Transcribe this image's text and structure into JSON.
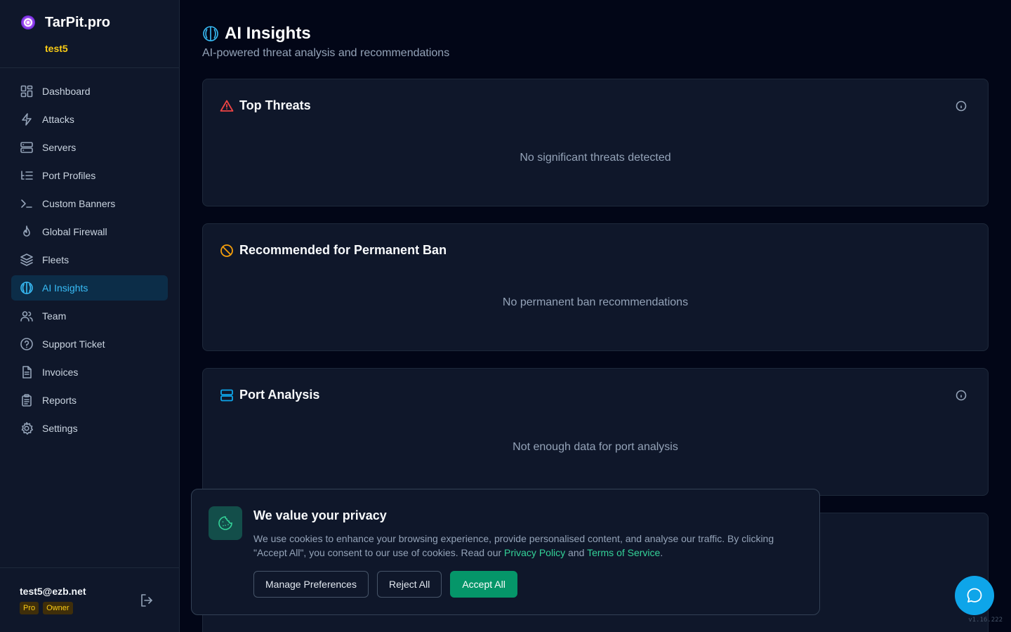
{
  "app": {
    "name": "TarPit.pro",
    "workspace": "test5",
    "version": "v1.16.222"
  },
  "sidebar": {
    "items": [
      {
        "label": "Dashboard",
        "icon": "grid-icon",
        "active": false
      },
      {
        "label": "Attacks",
        "icon": "lightning-icon",
        "active": false
      },
      {
        "label": "Servers",
        "icon": "server-icon",
        "active": false
      },
      {
        "label": "Port Profiles",
        "icon": "list-tree-icon",
        "active": false
      },
      {
        "label": "Custom Banners",
        "icon": "terminal-icon",
        "active": false
      },
      {
        "label": "Global Firewall",
        "icon": "flame-icon",
        "active": false
      },
      {
        "label": "Fleets",
        "icon": "layers-icon",
        "active": false
      },
      {
        "label": "AI Insights",
        "icon": "brain-icon",
        "active": true
      },
      {
        "label": "Team",
        "icon": "users-icon",
        "active": false
      },
      {
        "label": "Support Ticket",
        "icon": "help-circle-icon",
        "active": false
      },
      {
        "label": "Invoices",
        "icon": "file-text-icon",
        "active": false
      },
      {
        "label": "Reports",
        "icon": "clipboard-icon",
        "active": false
      },
      {
        "label": "Settings",
        "icon": "gear-icon",
        "active": false
      }
    ]
  },
  "user": {
    "email": "test5@ezb.net",
    "plan_badge": "Pro",
    "role_badge": "Owner"
  },
  "page": {
    "title": "AI Insights",
    "subtitle": "AI-powered threat analysis and recommendations"
  },
  "cards": [
    {
      "title": "Top Threats",
      "empty": "No significant threats detected",
      "icon": "alert-triangle-icon",
      "color": "#ef4444"
    },
    {
      "title": "Recommended for Permanent Ban",
      "empty": "No permanent ban recommendations",
      "icon": "ban-icon",
      "color": "#f59e0b"
    },
    {
      "title": "Port Analysis",
      "empty": "Not enough data for port analysis",
      "icon": "server-icon",
      "color": "#0ea5e9"
    }
  ],
  "cookie": {
    "title": "We value your privacy",
    "text_before": "We use cookies to enhance your browsing experience, provide personalised content, and analyse our traffic. By clicking \"Accept All\", you consent to our use of cookies. Read our ",
    "privacy_link": "Privacy Policy",
    "text_and": " and ",
    "terms_link": "Terms of Service",
    "text_end": ".",
    "manage_label": "Manage Preferences",
    "reject_label": "Reject All",
    "accept_label": "Accept All"
  },
  "colors": {
    "accent": "#38bdf8",
    "brand_yellow": "#facc15",
    "accept_green": "#059669",
    "link_green": "#34d399"
  }
}
